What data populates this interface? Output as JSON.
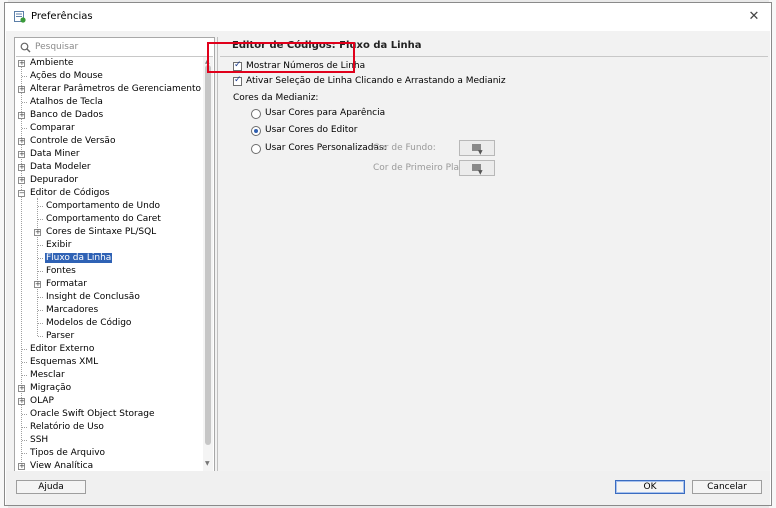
{
  "window": {
    "title": "Preferências"
  },
  "search": {
    "placeholder": "Pesquisar"
  },
  "tree": [
    {
      "label": "Ambiente",
      "expander": "+"
    },
    {
      "label": "Ações do Mouse",
      "expander": ""
    },
    {
      "label": "Alterar Parâmetros de Gerenciamento",
      "expander": "+"
    },
    {
      "label": "Atalhos de Tecla",
      "expander": ""
    },
    {
      "label": "Banco de Dados",
      "expander": "+"
    },
    {
      "label": "Comparar",
      "expander": ""
    },
    {
      "label": "Controle de Versão",
      "expander": "+"
    },
    {
      "label": "Data Miner",
      "expander": "+"
    },
    {
      "label": "Data Modeler",
      "expander": "+"
    },
    {
      "label": "Depurador",
      "expander": "+"
    },
    {
      "label": "Editor de Códigos",
      "expander": "-"
    },
    {
      "label": "Comportamento de Undo",
      "expander": "",
      "child": true
    },
    {
      "label": "Comportamento do Caret",
      "expander": "",
      "child": true
    },
    {
      "label": "Cores de Sintaxe PL/SQL",
      "expander": "+",
      "child": true
    },
    {
      "label": "Exibir",
      "expander": "",
      "child": true
    },
    {
      "label": "Fluxo da Linha",
      "expander": "",
      "child": true,
      "selected": true
    },
    {
      "label": "Fontes",
      "expander": "",
      "child": true
    },
    {
      "label": "Formatar",
      "expander": "+",
      "child": true
    },
    {
      "label": "Insight de Conclusão",
      "expander": "",
      "child": true
    },
    {
      "label": "Marcadores",
      "expander": "",
      "child": true
    },
    {
      "label": "Modelos de Código",
      "expander": "",
      "child": true
    },
    {
      "label": "Parser",
      "expander": "",
      "child": true
    },
    {
      "label": "Editor Externo",
      "expander": ""
    },
    {
      "label": "Esquemas XML",
      "expander": ""
    },
    {
      "label": "Mesclar",
      "expander": ""
    },
    {
      "label": "Migração",
      "expander": "+"
    },
    {
      "label": "OLAP",
      "expander": "+"
    },
    {
      "label": "Oracle Swift Object Storage",
      "expander": ""
    },
    {
      "label": "Relatório de Uso",
      "expander": ""
    },
    {
      "label": "SSH",
      "expander": ""
    },
    {
      "label": "Tipos de Arquivo",
      "expander": ""
    },
    {
      "label": "View Analítica",
      "expander": "+"
    }
  ],
  "panel": {
    "title": "Editor de Códigos: Fluxo da Linha",
    "show_line_numbers": {
      "label": "Mostrar Números de Linha",
      "checked": true
    },
    "enable_line_select": {
      "label": "Ativar Seleção de Linha Clicando e Arrastando a Medianiz",
      "checked": true
    },
    "gutter_colors_label": "Cores da Medianiz:",
    "radio_appearance": {
      "label": "Usar Cores para Aparência",
      "selected": false
    },
    "radio_editor": {
      "label": "Usar Cores do Editor",
      "selected": true
    },
    "radio_custom": {
      "label": "Usar Cores Personalizadas:",
      "selected": false
    },
    "background_color_label": "Cor de Fundo:",
    "foreground_color_label": "Cor de Primeiro Plano"
  },
  "buttons": {
    "help": "Ajuda",
    "ok": "OK",
    "cancel": "Cancelar"
  },
  "colors": {
    "selection": "#2f62b5",
    "highlight_box": "#e0001b"
  }
}
